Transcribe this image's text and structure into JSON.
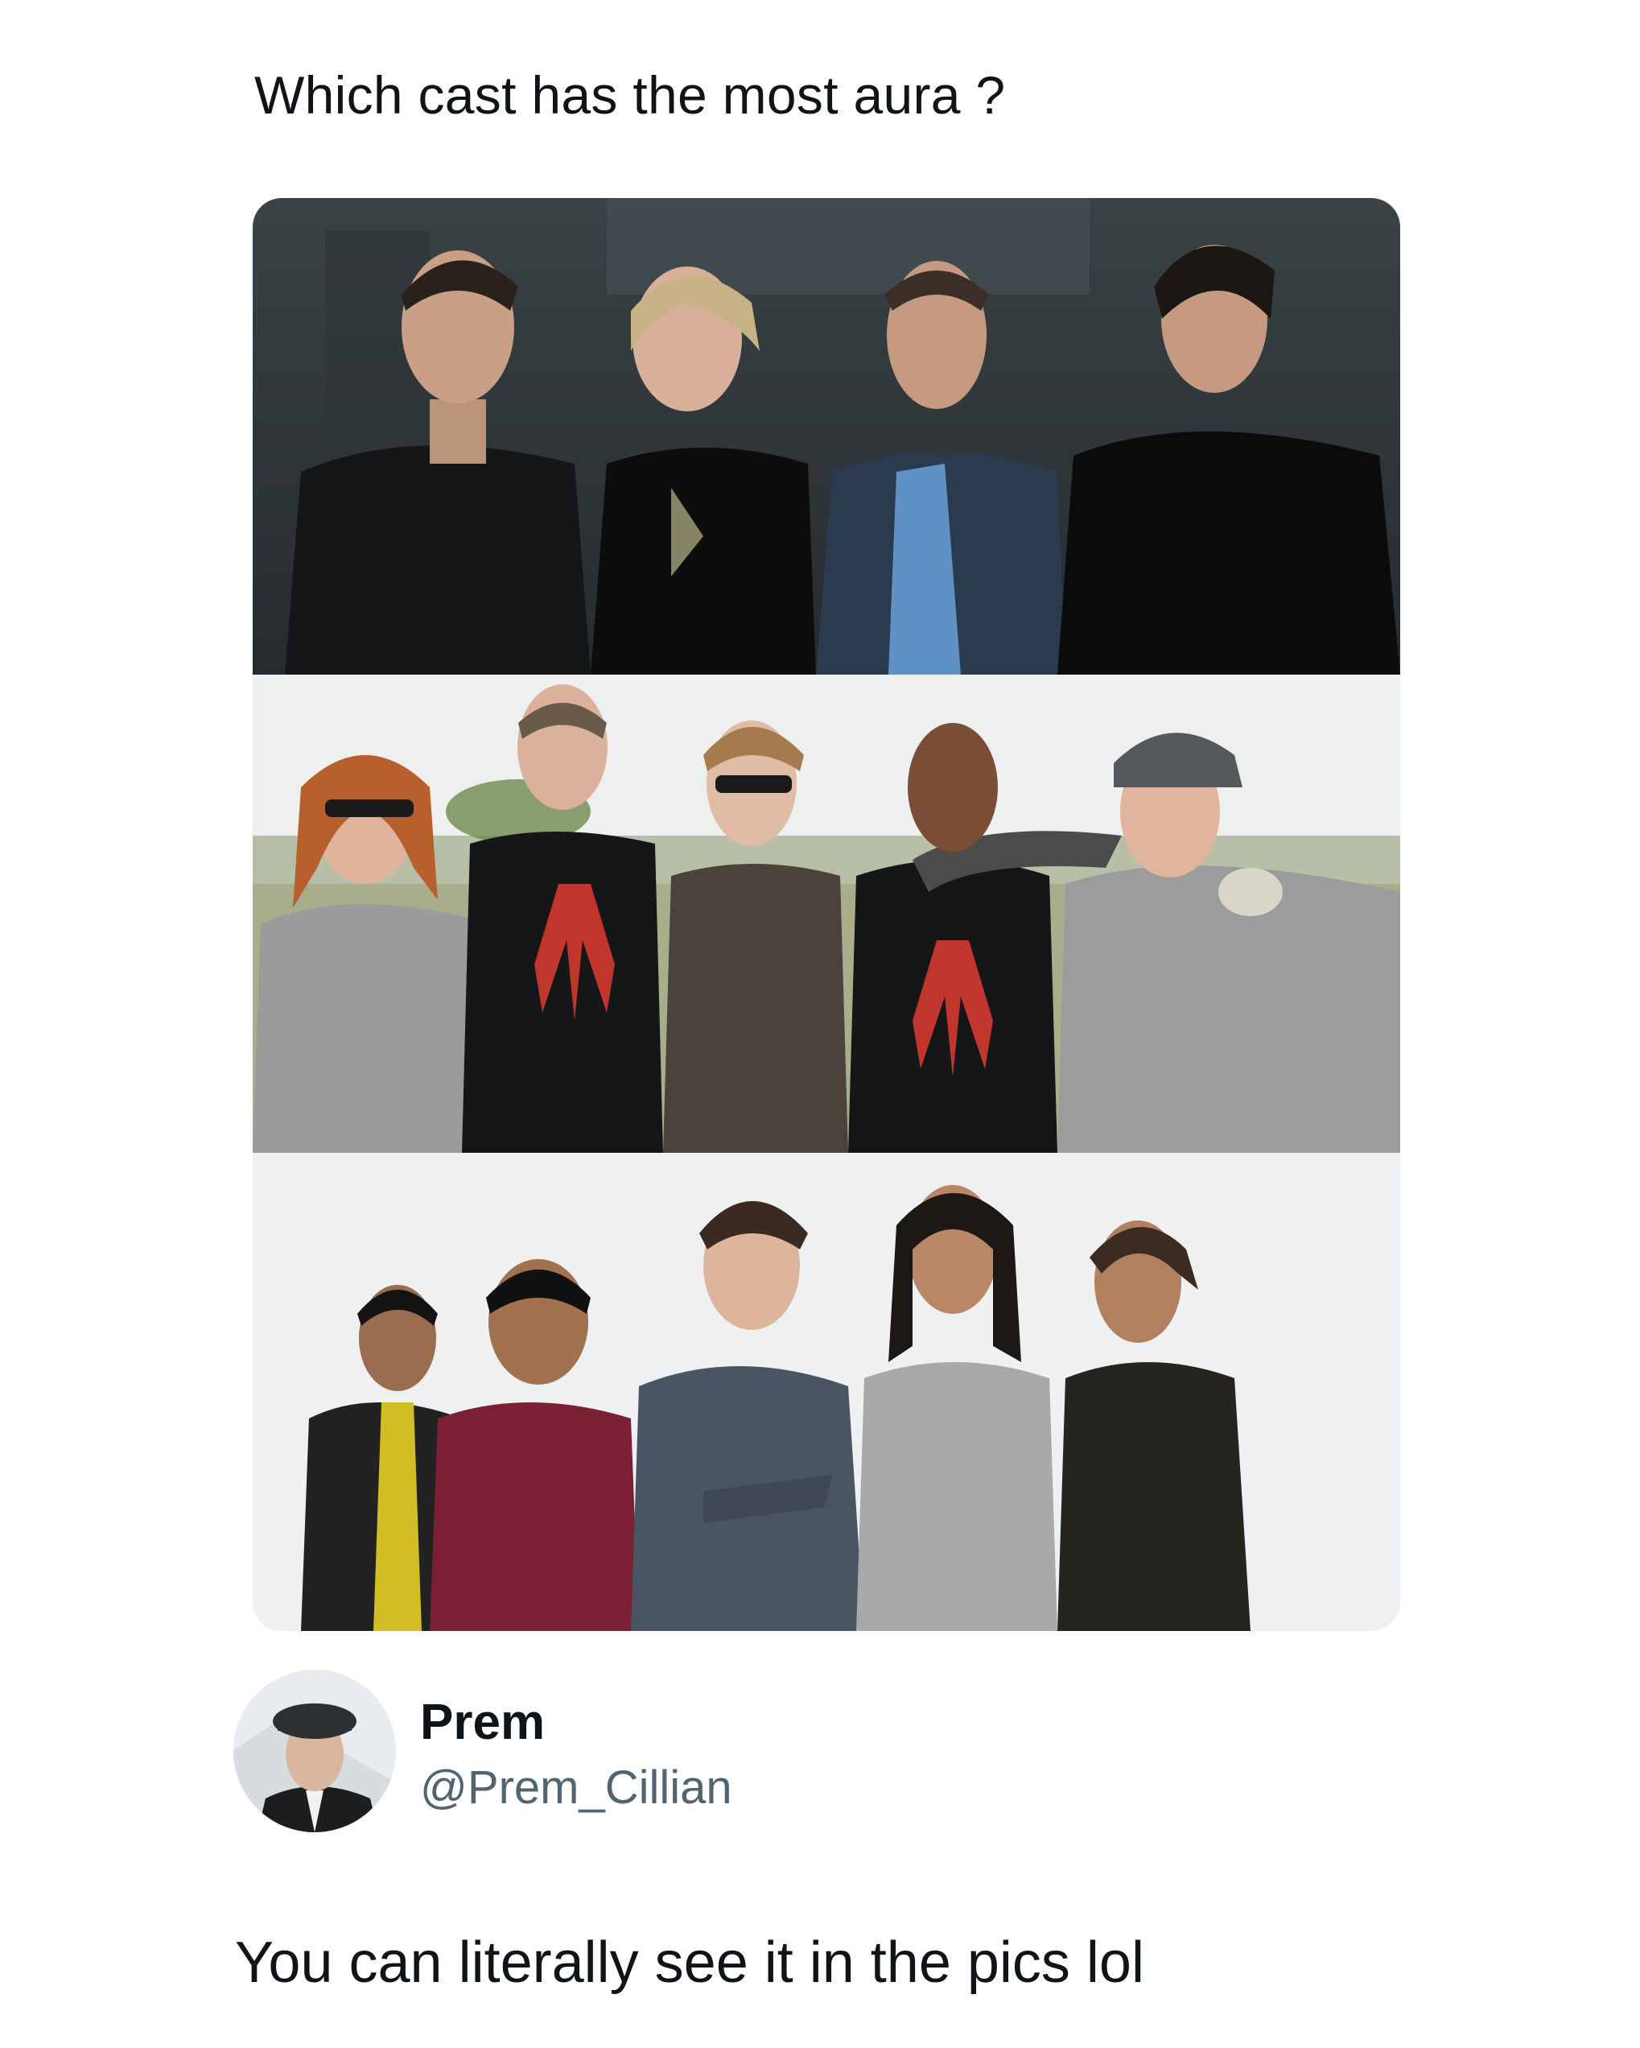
{
  "post": {
    "text": "Which cast has the most aura ?"
  },
  "media": {
    "photos": [
      {
        "name": "cast-photo-1"
      },
      {
        "name": "cast-photo-2"
      },
      {
        "name": "cast-photo-3"
      }
    ]
  },
  "reply_author": {
    "display_name": "Prem",
    "handle": "@Prem_Cillian"
  },
  "reply": {
    "text": "You can literally see it in the pics lol"
  },
  "colors": {
    "text_primary": "#0f1419",
    "text_secondary": "#536471",
    "background": "#ffffff"
  }
}
